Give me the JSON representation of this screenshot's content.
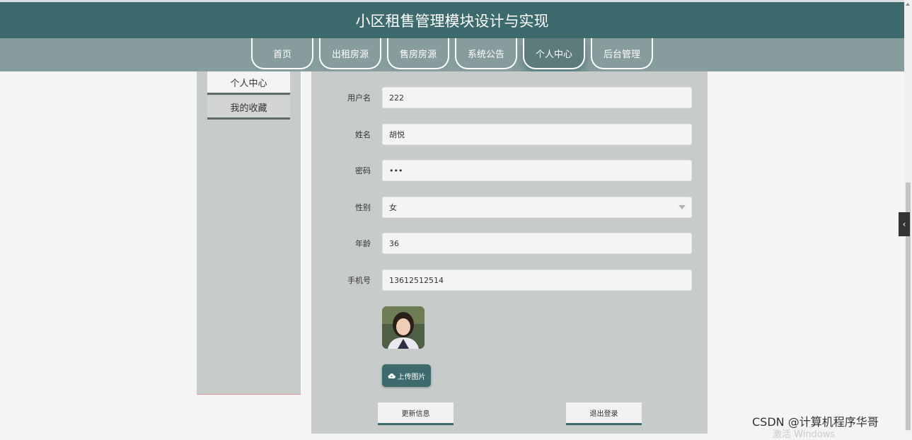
{
  "header": {
    "title": "小区租售管理模块设计与实现"
  },
  "nav": [
    {
      "label": "首页"
    },
    {
      "label": "出租房源"
    },
    {
      "label": "售房房源"
    },
    {
      "label": "系统公告"
    },
    {
      "label": "个人中心"
    },
    {
      "label": "后台管理"
    }
  ],
  "sidebar": [
    {
      "label": "个人中心"
    },
    {
      "label": "我的收藏"
    }
  ],
  "form": {
    "username_label": "用户名",
    "username_value": "222",
    "name_label": "姓名",
    "name_value": "胡悦",
    "password_label": "密码",
    "password_value": "•••",
    "gender_label": "性别",
    "gender_value": "女",
    "age_label": "年龄",
    "age_value": "36",
    "phone_label": "手机号",
    "phone_value": "13612512514",
    "upload_label": "上传图片",
    "update_label": "更新信息",
    "logout_label": "退出登录"
  },
  "watermark": "CSDN @计算机程序华哥",
  "activation_text": "激活 Windows",
  "colors": {
    "primary": "#3d6a6c",
    "nav_bg": "#879c9d",
    "panel_bg": "#c7cbca"
  },
  "icons": {
    "upload": "cloud-upload-icon",
    "toggle": "chevron-left-icon"
  }
}
